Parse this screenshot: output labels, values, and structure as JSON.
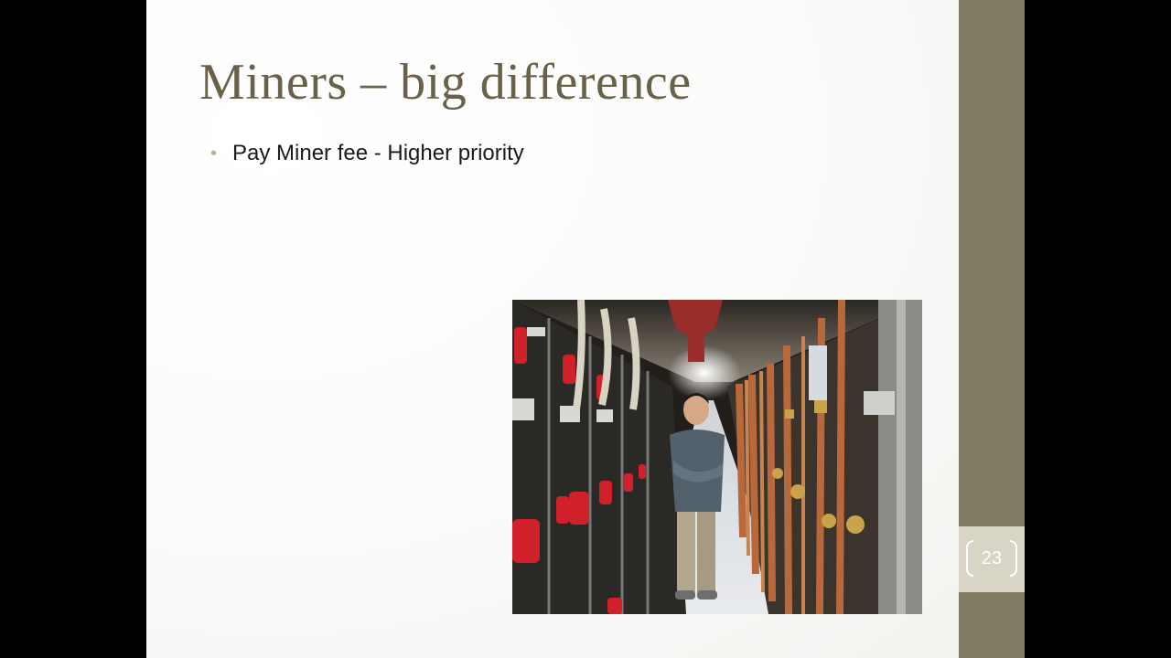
{
  "slide": {
    "title": "Miners – big difference",
    "bullets": [
      {
        "text": "Pay Miner fee - Higher priority"
      }
    ],
    "page_number": "23",
    "colors": {
      "title": "#6a6149",
      "side_band": "#817a63",
      "number_block": "#d9d5c6",
      "bullet_dot": "#b7b18e"
    },
    "image": {
      "icon": "photo-icon"
    }
  }
}
